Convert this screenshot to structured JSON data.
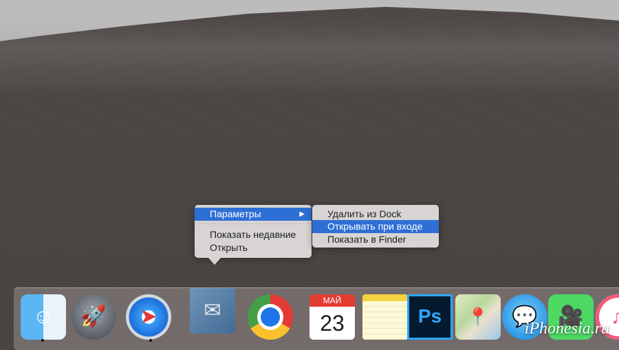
{
  "context_menu": {
    "items": [
      "Параметры",
      "Показать недавние",
      "Открыть"
    ],
    "submenu_arrow": "▶"
  },
  "submenu": {
    "items": [
      "Удалить из Dock",
      "Открывать при входе",
      "Показать в Finder"
    ],
    "selected": "Открывать при входе"
  },
  "dock": {
    "apps": [
      {
        "name": "Finder",
        "icon": "finder-icon"
      },
      {
        "name": "Launchpad",
        "icon": "rocket-icon"
      },
      {
        "name": "Safari",
        "icon": "compass-icon"
      },
      {
        "name": "Mail",
        "icon": "stamp-icon"
      },
      {
        "name": "Chrome",
        "icon": "chrome-icon"
      },
      {
        "name": "Calendar",
        "icon": "calendar-icon",
        "month": "МАЙ",
        "day": "23"
      },
      {
        "name": "Notes",
        "icon": "notes-icon"
      },
      {
        "name": "Photoshop",
        "icon": "photoshop-icon",
        "label": "Ps"
      },
      {
        "name": "Maps",
        "icon": "map-icon"
      },
      {
        "name": "Messages",
        "icon": "speech-bubble-icon"
      },
      {
        "name": "FaceTime",
        "icon": "video-camera-icon"
      },
      {
        "name": "iTunes",
        "icon": "music-note-icon"
      }
    ]
  },
  "watermark": "iPhonesia.ru",
  "colors": {
    "selection": "#2e6fd6",
    "menu_bg": "#dddbda"
  }
}
